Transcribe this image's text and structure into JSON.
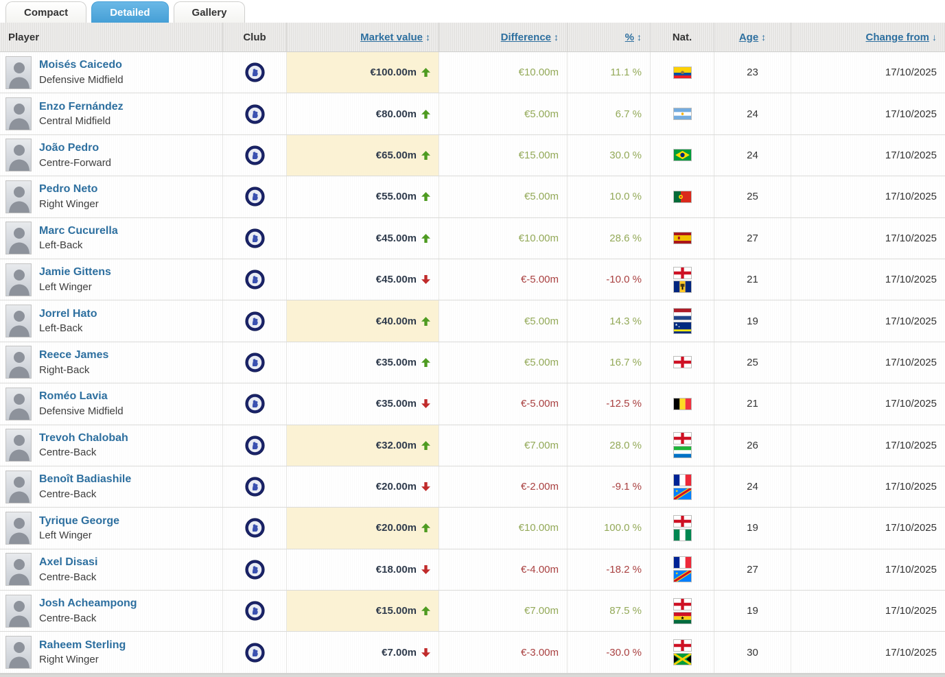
{
  "tabs": [
    {
      "label": "Compact",
      "active": false
    },
    {
      "label": "Detailed",
      "active": true
    },
    {
      "label": "Gallery",
      "active": false
    }
  ],
  "columns": {
    "player": "Player",
    "club": "Club",
    "market_value": "Market value",
    "difference": "Difference",
    "percent": "%",
    "nat": "Nat.",
    "age": "Age",
    "change_from": "Change from"
  },
  "sort": {
    "sortable_icon": "↕",
    "active_sort_icon": "↓"
  },
  "colors": {
    "tab_active": "#459fd6",
    "link": "#2d6f9f",
    "positive_text": "#93a958",
    "negative_text": "#a94040",
    "arrow_up": "#4e9b21",
    "arrow_down": "#c02b2b",
    "peak_value_bg": "#fbf2d4"
  },
  "players": [
    {
      "name": "Moisés Caicedo",
      "position": "Defensive Midfield",
      "club": "Chelsea FC",
      "market_value": "€100.00m",
      "trend": "up",
      "peak": true,
      "difference": "€10.00m",
      "percent": "11.1 %",
      "nationalities": [
        "Ecuador"
      ],
      "age": "23",
      "change_from": "17/10/2025"
    },
    {
      "name": "Enzo Fernández",
      "position": "Central Midfield",
      "club": "Chelsea FC",
      "market_value": "€80.00m",
      "trend": "up",
      "peak": false,
      "difference": "€5.00m",
      "percent": "6.7 %",
      "nationalities": [
        "Argentina"
      ],
      "age": "24",
      "change_from": "17/10/2025"
    },
    {
      "name": "João Pedro",
      "position": "Centre-Forward",
      "club": "Chelsea FC",
      "market_value": "€65.00m",
      "trend": "up",
      "peak": true,
      "difference": "€15.00m",
      "percent": "30.0 %",
      "nationalities": [
        "Brazil"
      ],
      "age": "24",
      "change_from": "17/10/2025"
    },
    {
      "name": "Pedro Neto",
      "position": "Right Winger",
      "club": "Chelsea FC",
      "market_value": "€55.00m",
      "trend": "up",
      "peak": false,
      "difference": "€5.00m",
      "percent": "10.0 %",
      "nationalities": [
        "Portugal"
      ],
      "age": "25",
      "change_from": "17/10/2025"
    },
    {
      "name": "Marc Cucurella",
      "position": "Left-Back",
      "club": "Chelsea FC",
      "market_value": "€45.00m",
      "trend": "up",
      "peak": false,
      "difference": "€10.00m",
      "percent": "28.6 %",
      "nationalities": [
        "Spain"
      ],
      "age": "27",
      "change_from": "17/10/2025"
    },
    {
      "name": "Jamie Gittens",
      "position": "Left Winger",
      "club": "Chelsea FC",
      "market_value": "€45.00m",
      "trend": "down",
      "peak": false,
      "difference": "€-5.00m",
      "percent": "-10.0 %",
      "nationalities": [
        "England",
        "Barbados"
      ],
      "age": "21",
      "change_from": "17/10/2025"
    },
    {
      "name": "Jorrel Hato",
      "position": "Left-Back",
      "club": "Chelsea FC",
      "market_value": "€40.00m",
      "trend": "up",
      "peak": true,
      "difference": "€5.00m",
      "percent": "14.3 %",
      "nationalities": [
        "Netherlands",
        "Curacao"
      ],
      "age": "19",
      "change_from": "17/10/2025"
    },
    {
      "name": "Reece James",
      "position": "Right-Back",
      "club": "Chelsea FC",
      "market_value": "€35.00m",
      "trend": "up",
      "peak": false,
      "difference": "€5.00m",
      "percent": "16.7 %",
      "nationalities": [
        "England"
      ],
      "age": "25",
      "change_from": "17/10/2025"
    },
    {
      "name": "Roméo Lavia",
      "position": "Defensive Midfield",
      "club": "Chelsea FC",
      "market_value": "€35.00m",
      "trend": "down",
      "peak": false,
      "difference": "€-5.00m",
      "percent": "-12.5 %",
      "nationalities": [
        "Belgium"
      ],
      "age": "21",
      "change_from": "17/10/2025"
    },
    {
      "name": "Trevoh Chalobah",
      "position": "Centre-Back",
      "club": "Chelsea FC",
      "market_value": "€32.00m",
      "trend": "up",
      "peak": true,
      "difference": "€7.00m",
      "percent": "28.0 %",
      "nationalities": [
        "England",
        "Sierra Leone"
      ],
      "age": "26",
      "change_from": "17/10/2025"
    },
    {
      "name": "Benoît Badiashile",
      "position": "Centre-Back",
      "club": "Chelsea FC",
      "market_value": "€20.00m",
      "trend": "down",
      "peak": false,
      "difference": "€-2.00m",
      "percent": "-9.1 %",
      "nationalities": [
        "France",
        "DR Congo"
      ],
      "age": "24",
      "change_from": "17/10/2025"
    },
    {
      "name": "Tyrique George",
      "position": "Left Winger",
      "club": "Chelsea FC",
      "market_value": "€20.00m",
      "trend": "up",
      "peak": true,
      "difference": "€10.00m",
      "percent": "100.0 %",
      "nationalities": [
        "England",
        "Nigeria"
      ],
      "age": "19",
      "change_from": "17/10/2025"
    },
    {
      "name": "Axel Disasi",
      "position": "Centre-Back",
      "club": "Chelsea FC",
      "market_value": "€18.00m",
      "trend": "down",
      "peak": false,
      "difference": "€-4.00m",
      "percent": "-18.2 %",
      "nationalities": [
        "France",
        "DR Congo"
      ],
      "age": "27",
      "change_from": "17/10/2025"
    },
    {
      "name": "Josh Acheampong",
      "position": "Centre-Back",
      "club": "Chelsea FC",
      "market_value": "€15.00m",
      "trend": "up",
      "peak": true,
      "difference": "€7.00m",
      "percent": "87.5 %",
      "nationalities": [
        "England",
        "Ghana"
      ],
      "age": "19",
      "change_from": "17/10/2025"
    },
    {
      "name": "Raheem Sterling",
      "position": "Right Winger",
      "club": "Chelsea FC",
      "market_value": "€7.00m",
      "trend": "down",
      "peak": false,
      "difference": "€-3.00m",
      "percent": "-30.0 %",
      "nationalities": [
        "England",
        "Jamaica"
      ],
      "age": "30",
      "change_from": "17/10/2025"
    }
  ]
}
